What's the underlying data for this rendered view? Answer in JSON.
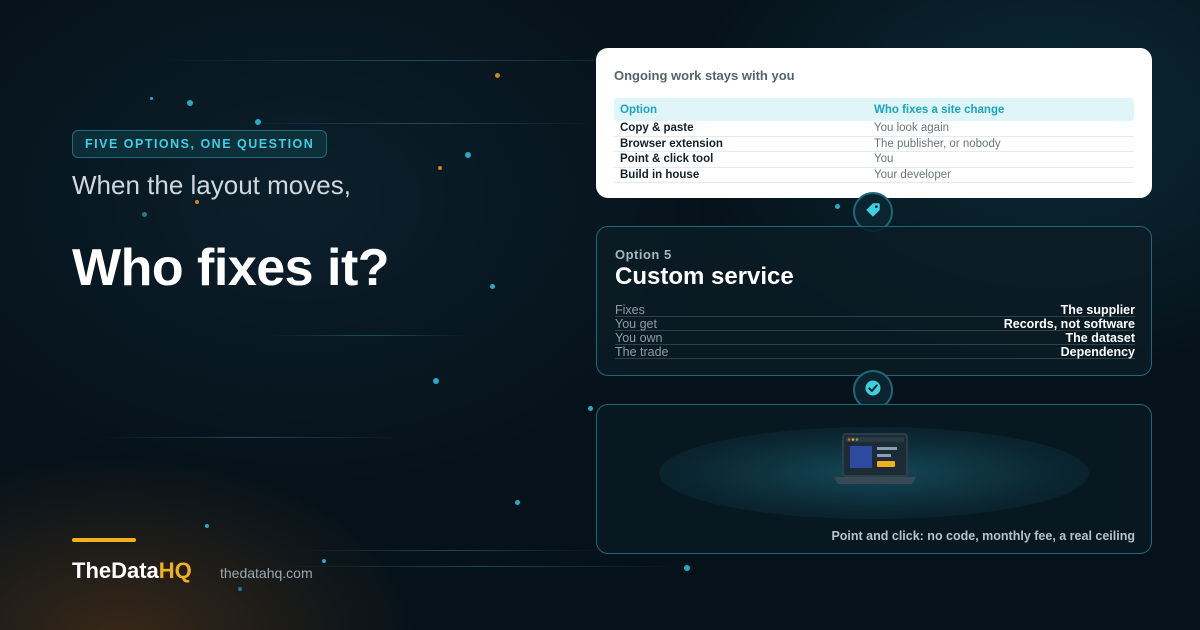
{
  "left": {
    "badge": "FIVE OPTIONS, ONE QUESTION",
    "lead": "When the layout moves,",
    "headline": "Who fixes it?",
    "brand": {
      "name_main": "TheData",
      "name_accent": "HQ",
      "domain": "thedatahq.com"
    }
  },
  "table_card": {
    "title": "Ongoing work stays with you",
    "columns": [
      "Option",
      "Who fixes a site change"
    ],
    "rows": [
      [
        "Copy & paste",
        "You look again"
      ],
      [
        "Browser extension",
        "The publisher, or nobody"
      ],
      [
        "Point & click tool",
        "You"
      ],
      [
        "Build in house",
        "Your developer"
      ]
    ]
  },
  "service_card": {
    "label": "Option 5",
    "title": "Custom service",
    "rows": [
      [
        "Fixes",
        "The supplier"
      ],
      [
        "You get",
        "Records, not software"
      ],
      [
        "You own",
        "The dataset"
      ],
      [
        "The trade",
        "Dependency"
      ]
    ]
  },
  "illustration_card": {
    "caption": "Point and click: no code, monthly fee, a real ceiling"
  },
  "icons": {
    "node_top": "tag-icon",
    "node_bottom": "check-circle-icon",
    "illustration": "laptop-icon"
  },
  "colors": {
    "background": "#06121a",
    "accent_cyan": "#3fd0e0",
    "accent_yellow": "#f2b11a",
    "border_teal": "#1f6877"
  }
}
